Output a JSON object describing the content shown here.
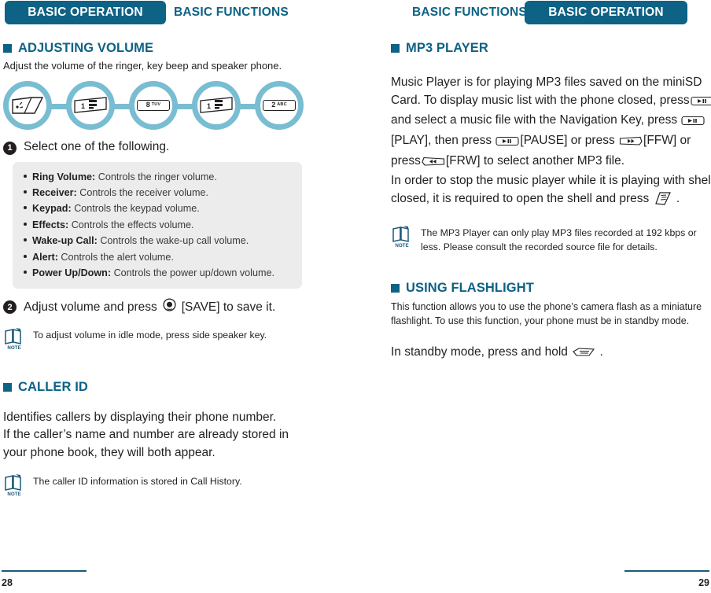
{
  "header": {
    "left_active_tab": "BASIC OPERATION",
    "left_inactive_tab": "BASIC FUNCTIONS",
    "right_inactive_tab": "BASIC FUNCTIONS",
    "right_active_tab": "BASIC OPERATION"
  },
  "left_page": {
    "adjusting_volume": {
      "heading": "ADJUSTING VOLUME",
      "intro": "Adjust the volume of the ringer, key beep and speaker phone.",
      "flow_keys": [
        {
          "icon": "flip-open-key-icon",
          "label": ""
        },
        {
          "icon": "key-1-icon",
          "label": "1"
        },
        {
          "icon": "key-8-tuv-icon",
          "label": "8",
          "sub": "TUV"
        },
        {
          "icon": "key-1-icon",
          "label": "1"
        },
        {
          "icon": "key-2-abc-icon",
          "label": "2",
          "sub": "ABC"
        }
      ],
      "step1": {
        "number": "1",
        "text": "Select one of the following."
      },
      "options": [
        {
          "term": "Ring Volume:",
          "desc": "Controls the ringer volume."
        },
        {
          "term": "Receiver:",
          "desc": "Controls the receiver volume."
        },
        {
          "term": "Keypad:",
          "desc": "Controls the keypad volume."
        },
        {
          "term": "Effects:",
          "desc": "Controls the effects volume."
        },
        {
          "term": "Wake-up Call:",
          "desc": "Controls the wake-up call volume."
        },
        {
          "term": "Alert:",
          "desc": "Controls the alert volume."
        },
        {
          "term": "Power Up/Down:",
          "desc": "Controls the power up/down volume."
        }
      ],
      "step2": {
        "number": "2",
        "text_before": "Adjust volume and press",
        "key_icon": "ok-center-key-icon",
        "text_after": "[SAVE] to save it."
      },
      "note": "To adjust volume in idle mode, press side speaker key."
    },
    "caller_id": {
      "heading": "CALLER ID",
      "body_line1": "Identifies callers by displaying their phone number.",
      "body_line2": "If the caller’s name and number are already stored in",
      "body_line3": "your phone book, they will both appear.",
      "note": "The caller ID information is stored in Call History."
    },
    "page_number": "28"
  },
  "right_page": {
    "mp3_player": {
      "heading": "MP3 PLAYER",
      "line1_a": "Music Player is for playing MP3 files saved on the miniSD",
      "line2_a": "Card. To display music list with the phone closed, press",
      "line2_key": "play-pause-key-icon",
      "line3_a": "and select a music file with the Navigation Key, press",
      "line3_key": "play-pause-key-icon",
      "line4_a": "[PLAY], then press",
      "line4_key": "play-pause-key-icon",
      "line4_b": "[PAUSE] or press",
      "line4_key2": "ffw-key-icon",
      "line4_c": "[FFW] or",
      "line5_a": "press",
      "line5_key": "frw-key-icon",
      "line5_b": "[FRW] to select another MP3 file.",
      "line6": "In order to stop the music player while it is playing with shell",
      "line7_a": "closed, it is required to open the shell and press",
      "line7_key": "end-shell-key-icon",
      "line7_b": ".",
      "note_line1": "The MP3 Player can only play MP3 files recorded at 192 kbps or",
      "note_line2": "less. Please consult the recorded source file for details."
    },
    "using_flashlight": {
      "heading": "USING FLASHLIGHT",
      "body_line1": "This function allows you to use the phone’s camera flash as a miniature",
      "body_line2": "flashlight. To use this function, your phone must be in standby mode.",
      "action_before": "In standby mode, press and hold",
      "action_key": "flashlight-key-icon",
      "action_after": "."
    },
    "page_number": "29"
  },
  "colors": {
    "brand_teal": "#0d6285",
    "flow_teal": "#79bdd2",
    "box_gray": "#ececec",
    "text_dark": "#231f20"
  }
}
